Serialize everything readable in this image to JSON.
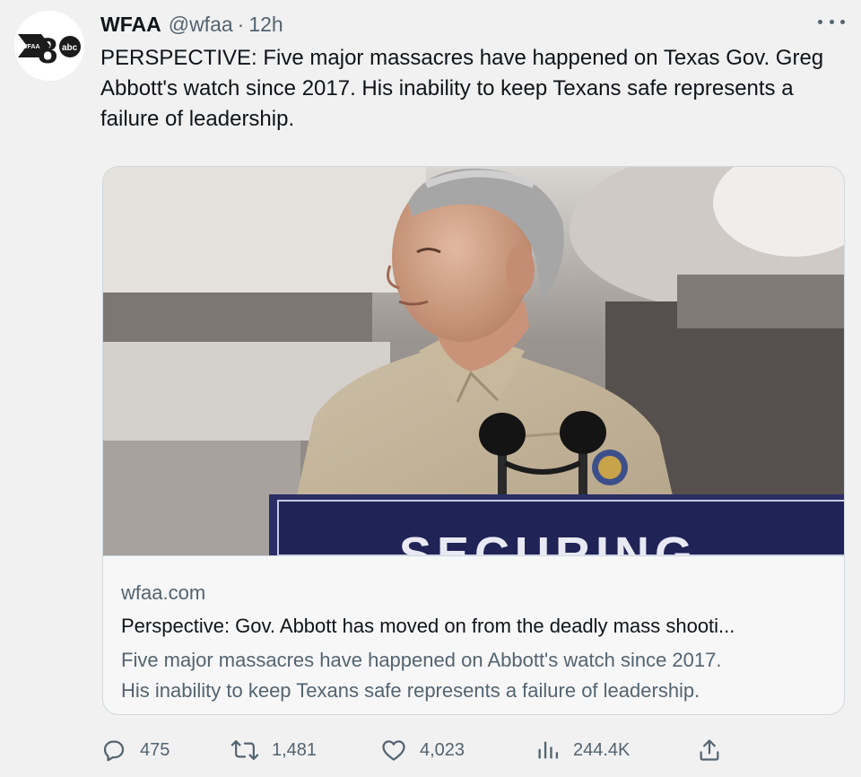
{
  "tweet": {
    "author": {
      "name": "WFAA",
      "handle": "@wfaa",
      "separator": "·",
      "time": "12h",
      "avatar_logo_text": "WFAA 8 abc"
    },
    "text_lines": [
      "PERSPECTIVE: Five major massacres have happened on Texas Gov. Greg",
      "Abbott's watch since 2017. His inability to keep Texans safe represents a",
      "failure of leadership."
    ],
    "card": {
      "image_description": "Photo of Gov. Greg Abbott at a podium",
      "podium_sign_text": "SECURING",
      "domain": "wfaa.com",
      "title": "Perspective: Gov. Abbott has moved on from the deadly mass shooti...",
      "description_lines": [
        "Five major massacres have happened on Abbott's watch since 2017.",
        "His inability to keep Texans safe represents a failure of leadership."
      ]
    },
    "actions": {
      "replies": "475",
      "retweets": "1,481",
      "likes": "4,023",
      "views": "244.4K"
    }
  },
  "colors": {
    "text_primary": "#0f1419",
    "text_secondary": "#536471",
    "border": "#cfd9de",
    "background": "#f1f1f1"
  },
  "icons": {
    "reply": "speech-bubble-icon",
    "retweet": "retweet-arrows-icon",
    "like": "heart-icon",
    "views": "bar-chart-icon",
    "share": "share-upload-icon",
    "more": "ellipsis-icon"
  }
}
